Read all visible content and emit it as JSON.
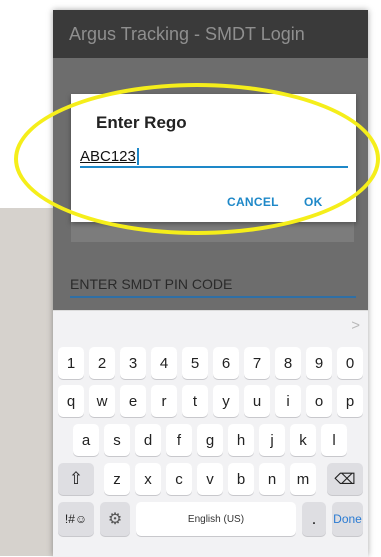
{
  "appbar": {
    "title": "Argus Tracking - SMDT Login"
  },
  "dialog": {
    "title": "Enter Rego",
    "input_value": "ABC123",
    "cancel_label": "CANCEL",
    "ok_label": "OK"
  },
  "pin_field": {
    "placeholder": "ENTER SMDT PIN CODE"
  },
  "keyboard": {
    "suggestion_chevron": ">",
    "row_numbers": [
      "1",
      "2",
      "3",
      "4",
      "5",
      "6",
      "7",
      "8",
      "9",
      "0"
    ],
    "row_top": [
      "q",
      "w",
      "e",
      "r",
      "t",
      "y",
      "u",
      "i",
      "o",
      "p"
    ],
    "row_mid": [
      "a",
      "s",
      "d",
      "f",
      "g",
      "h",
      "j",
      "k",
      "l"
    ],
    "row_bottom": [
      "z",
      "x",
      "c",
      "v",
      "b",
      "n",
      "m"
    ],
    "shift_icon": "⇧",
    "backspace_icon": "⌫",
    "symbols_label": "!#☺",
    "settings_icon": "⚙",
    "space_label": "English (US)",
    "period_label": ".",
    "done_label": "Done"
  },
  "colors": {
    "highlight": "#f5ee1a",
    "accent": "#1e88c8",
    "appbar": "#3a3a3a",
    "overlay": "#6d6d6d"
  }
}
